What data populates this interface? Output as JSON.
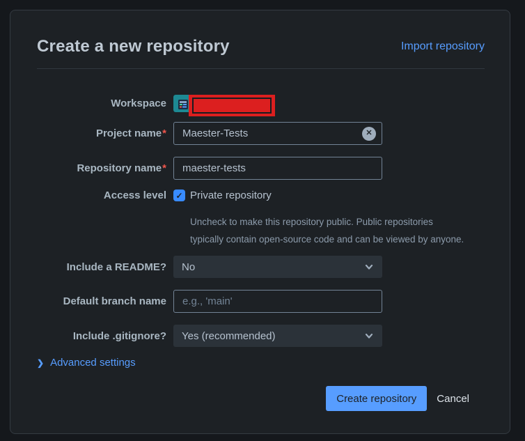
{
  "header": {
    "title": "Create a new repository",
    "import_link": "Import repository"
  },
  "form": {
    "workspace": {
      "label": "Workspace"
    },
    "project_name": {
      "label": "Project name",
      "required": "*",
      "value": "Maester-Tests"
    },
    "repository_name": {
      "label": "Repository name",
      "required": "*",
      "value": "maester-tests"
    },
    "access_level": {
      "label": "Access level",
      "checkbox_label": "Private repository",
      "checked": true,
      "helper_lines": [
        "Uncheck to make this repository public. Public repositories",
        "typically contain open-source code and can be viewed by anyone."
      ]
    },
    "include_readme": {
      "label": "Include a README?",
      "value": "No"
    },
    "default_branch_name": {
      "label": "Default branch name",
      "placeholder": "e.g., 'main'"
    },
    "include_gitignore": {
      "label": "Include .gitignore?",
      "value": "Yes (recommended)"
    },
    "advanced_settings": {
      "label": "Advanced settings"
    }
  },
  "footer": {
    "create_button": "Create repository",
    "cancel_button": "Cancel"
  },
  "icons": {
    "check": "✓",
    "clear": "✕",
    "chevron_right": "❯"
  },
  "colors": {
    "accent_blue": "#579DFF",
    "checkbox_blue": "#388BFF",
    "redaction_red": "#DC1F1F",
    "required_red": "#F0564C",
    "avatar_teal": "#1D8993"
  }
}
